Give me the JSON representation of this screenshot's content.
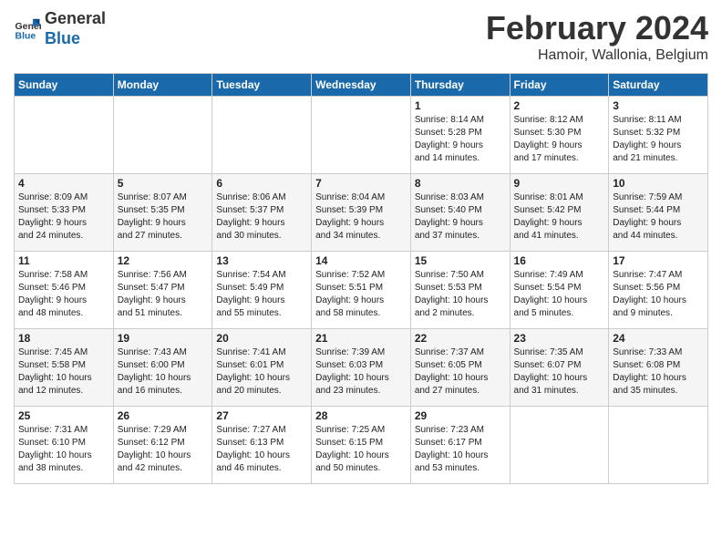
{
  "logo": {
    "line1": "General",
    "line2": "Blue"
  },
  "header": {
    "month": "February 2024",
    "location": "Hamoir, Wallonia, Belgium"
  },
  "days_of_week": [
    "Sunday",
    "Monday",
    "Tuesday",
    "Wednesday",
    "Thursday",
    "Friday",
    "Saturday"
  ],
  "weeks": [
    [
      {
        "day": "",
        "info": ""
      },
      {
        "day": "",
        "info": ""
      },
      {
        "day": "",
        "info": ""
      },
      {
        "day": "",
        "info": ""
      },
      {
        "day": "1",
        "info": "Sunrise: 8:14 AM\nSunset: 5:28 PM\nDaylight: 9 hours\nand 14 minutes."
      },
      {
        "day": "2",
        "info": "Sunrise: 8:12 AM\nSunset: 5:30 PM\nDaylight: 9 hours\nand 17 minutes."
      },
      {
        "day": "3",
        "info": "Sunrise: 8:11 AM\nSunset: 5:32 PM\nDaylight: 9 hours\nand 21 minutes."
      }
    ],
    [
      {
        "day": "4",
        "info": "Sunrise: 8:09 AM\nSunset: 5:33 PM\nDaylight: 9 hours\nand 24 minutes."
      },
      {
        "day": "5",
        "info": "Sunrise: 8:07 AM\nSunset: 5:35 PM\nDaylight: 9 hours\nand 27 minutes."
      },
      {
        "day": "6",
        "info": "Sunrise: 8:06 AM\nSunset: 5:37 PM\nDaylight: 9 hours\nand 30 minutes."
      },
      {
        "day": "7",
        "info": "Sunrise: 8:04 AM\nSunset: 5:39 PM\nDaylight: 9 hours\nand 34 minutes."
      },
      {
        "day": "8",
        "info": "Sunrise: 8:03 AM\nSunset: 5:40 PM\nDaylight: 9 hours\nand 37 minutes."
      },
      {
        "day": "9",
        "info": "Sunrise: 8:01 AM\nSunset: 5:42 PM\nDaylight: 9 hours\nand 41 minutes."
      },
      {
        "day": "10",
        "info": "Sunrise: 7:59 AM\nSunset: 5:44 PM\nDaylight: 9 hours\nand 44 minutes."
      }
    ],
    [
      {
        "day": "11",
        "info": "Sunrise: 7:58 AM\nSunset: 5:46 PM\nDaylight: 9 hours\nand 48 minutes."
      },
      {
        "day": "12",
        "info": "Sunrise: 7:56 AM\nSunset: 5:47 PM\nDaylight: 9 hours\nand 51 minutes."
      },
      {
        "day": "13",
        "info": "Sunrise: 7:54 AM\nSunset: 5:49 PM\nDaylight: 9 hours\nand 55 minutes."
      },
      {
        "day": "14",
        "info": "Sunrise: 7:52 AM\nSunset: 5:51 PM\nDaylight: 9 hours\nand 58 minutes."
      },
      {
        "day": "15",
        "info": "Sunrise: 7:50 AM\nSunset: 5:53 PM\nDaylight: 10 hours\nand 2 minutes."
      },
      {
        "day": "16",
        "info": "Sunrise: 7:49 AM\nSunset: 5:54 PM\nDaylight: 10 hours\nand 5 minutes."
      },
      {
        "day": "17",
        "info": "Sunrise: 7:47 AM\nSunset: 5:56 PM\nDaylight: 10 hours\nand 9 minutes."
      }
    ],
    [
      {
        "day": "18",
        "info": "Sunrise: 7:45 AM\nSunset: 5:58 PM\nDaylight: 10 hours\nand 12 minutes."
      },
      {
        "day": "19",
        "info": "Sunrise: 7:43 AM\nSunset: 6:00 PM\nDaylight: 10 hours\nand 16 minutes."
      },
      {
        "day": "20",
        "info": "Sunrise: 7:41 AM\nSunset: 6:01 PM\nDaylight: 10 hours\nand 20 minutes."
      },
      {
        "day": "21",
        "info": "Sunrise: 7:39 AM\nSunset: 6:03 PM\nDaylight: 10 hours\nand 23 minutes."
      },
      {
        "day": "22",
        "info": "Sunrise: 7:37 AM\nSunset: 6:05 PM\nDaylight: 10 hours\nand 27 minutes."
      },
      {
        "day": "23",
        "info": "Sunrise: 7:35 AM\nSunset: 6:07 PM\nDaylight: 10 hours\nand 31 minutes."
      },
      {
        "day": "24",
        "info": "Sunrise: 7:33 AM\nSunset: 6:08 PM\nDaylight: 10 hours\nand 35 minutes."
      }
    ],
    [
      {
        "day": "25",
        "info": "Sunrise: 7:31 AM\nSunset: 6:10 PM\nDaylight: 10 hours\nand 38 minutes."
      },
      {
        "day": "26",
        "info": "Sunrise: 7:29 AM\nSunset: 6:12 PM\nDaylight: 10 hours\nand 42 minutes."
      },
      {
        "day": "27",
        "info": "Sunrise: 7:27 AM\nSunset: 6:13 PM\nDaylight: 10 hours\nand 46 minutes."
      },
      {
        "day": "28",
        "info": "Sunrise: 7:25 AM\nSunset: 6:15 PM\nDaylight: 10 hours\nand 50 minutes."
      },
      {
        "day": "29",
        "info": "Sunrise: 7:23 AM\nSunset: 6:17 PM\nDaylight: 10 hours\nand 53 minutes."
      },
      {
        "day": "",
        "info": ""
      },
      {
        "day": "",
        "info": ""
      }
    ]
  ]
}
